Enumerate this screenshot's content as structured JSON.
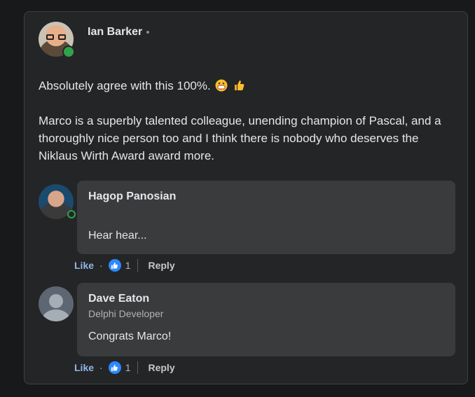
{
  "post": {
    "author": "Ian Barker",
    "paragraph1": "Absolutely agree with this 100%.",
    "paragraph1_emojis": [
      "grinning-face-emoji",
      "thumbs-up-emoji"
    ],
    "paragraph2": "Marco is a superbly talented colleague, unending champion of Pascal, and a thoroughly nice person too and I think there is nobody who deserves the Niklaus Wirth Award award more."
  },
  "replies": [
    {
      "author": "Hagop Panosian",
      "subtitle": "",
      "text": "Hear hear...",
      "like_label": "Like",
      "like_count": "1",
      "reply_label": "Reply"
    },
    {
      "author": "Dave Eaton",
      "subtitle": "Delphi Developer",
      "text": "Congrats Marco!",
      "like_label": "Like",
      "like_count": "1",
      "reply_label": "Reply"
    }
  ],
  "colors": {
    "background": "#18191a",
    "card": "#242526",
    "bubble": "#3a3b3c",
    "online": "#31a24c",
    "like_blue": "#2d88ff"
  }
}
